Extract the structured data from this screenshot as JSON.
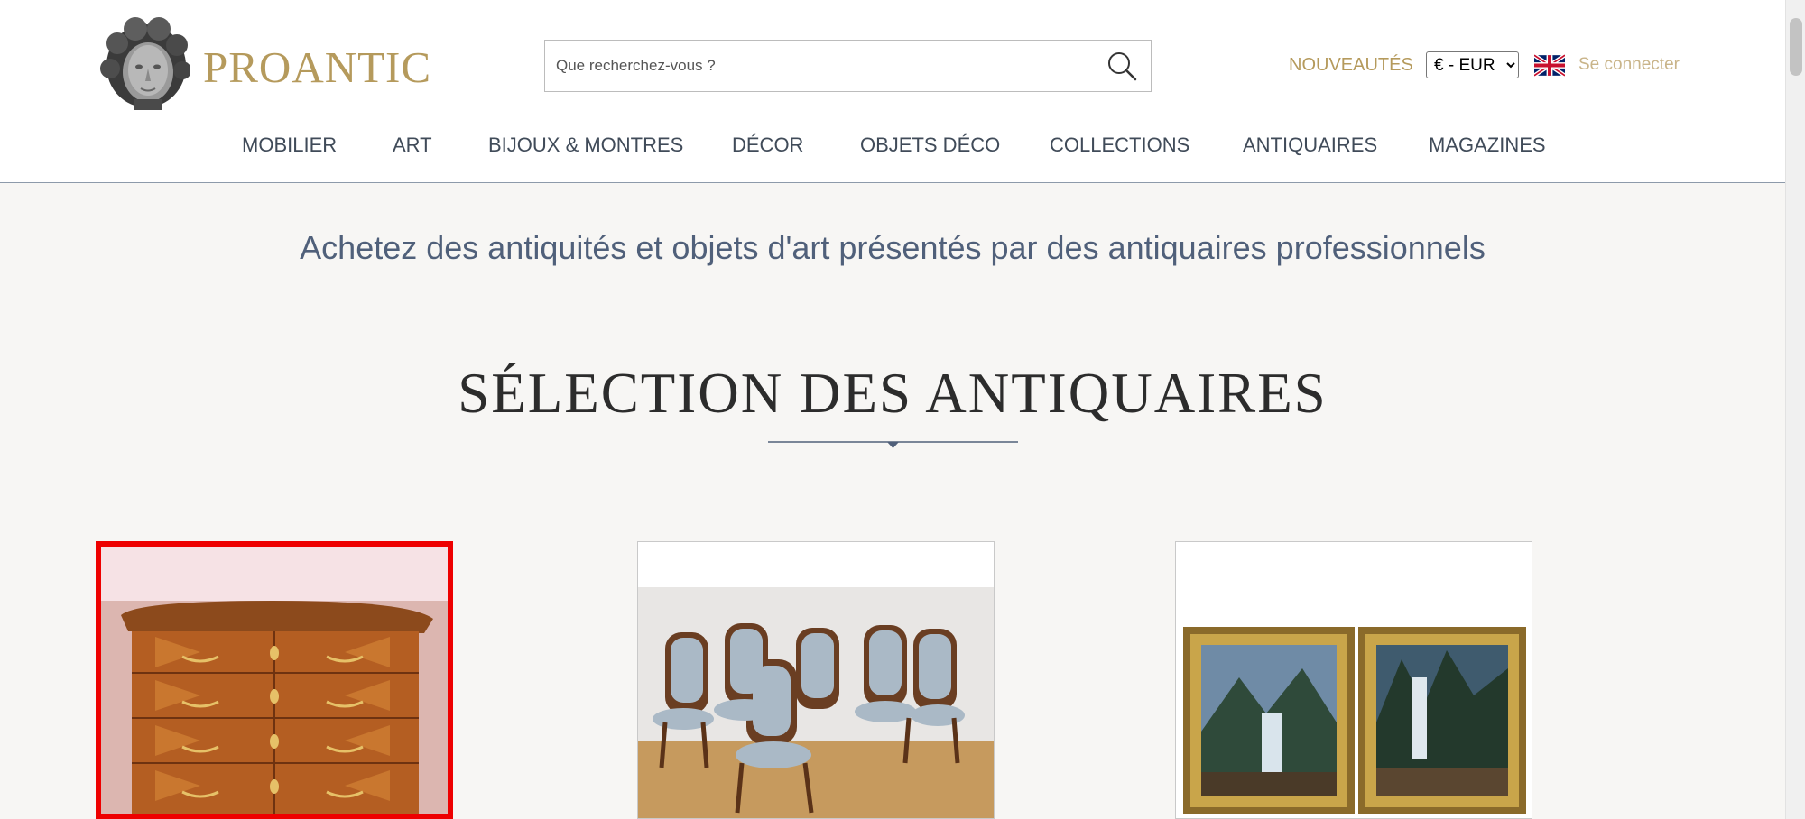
{
  "header": {
    "brand": "PROANTIC",
    "search": {
      "placeholder": "Que recherchez-vous ?"
    },
    "nouveautes": "NOUVEAUTÉS",
    "currency": {
      "selected": "€ - EUR"
    },
    "login": "Se connecter"
  },
  "nav": {
    "items": [
      {
        "label": "MOBILIER"
      },
      {
        "label": "ART"
      },
      {
        "label": "BIJOUX & MONTRES"
      },
      {
        "label": "DÉCOR"
      },
      {
        "label": "OBJETS DÉCO"
      },
      {
        "label": "COLLECTIONS"
      },
      {
        "label": "ANTIQUAIRES"
      },
      {
        "label": "MAGAZINES"
      }
    ]
  },
  "main": {
    "tagline": "Achetez des antiquités et objets d'art présentés par des antiquaires professionnels",
    "section_title": "SÉLECTION DES ANTIQUAIRES"
  },
  "colors": {
    "gold": "#b59a5c",
    "nav_text": "#404b59",
    "tagline": "#50607a",
    "selected_border": "#ee0000",
    "page_background": "#f7f6f4"
  },
  "icons": [
    "search-icon",
    "uk-flag-icon",
    "chevron-down-icon",
    "logo-sculpture-icon"
  ]
}
